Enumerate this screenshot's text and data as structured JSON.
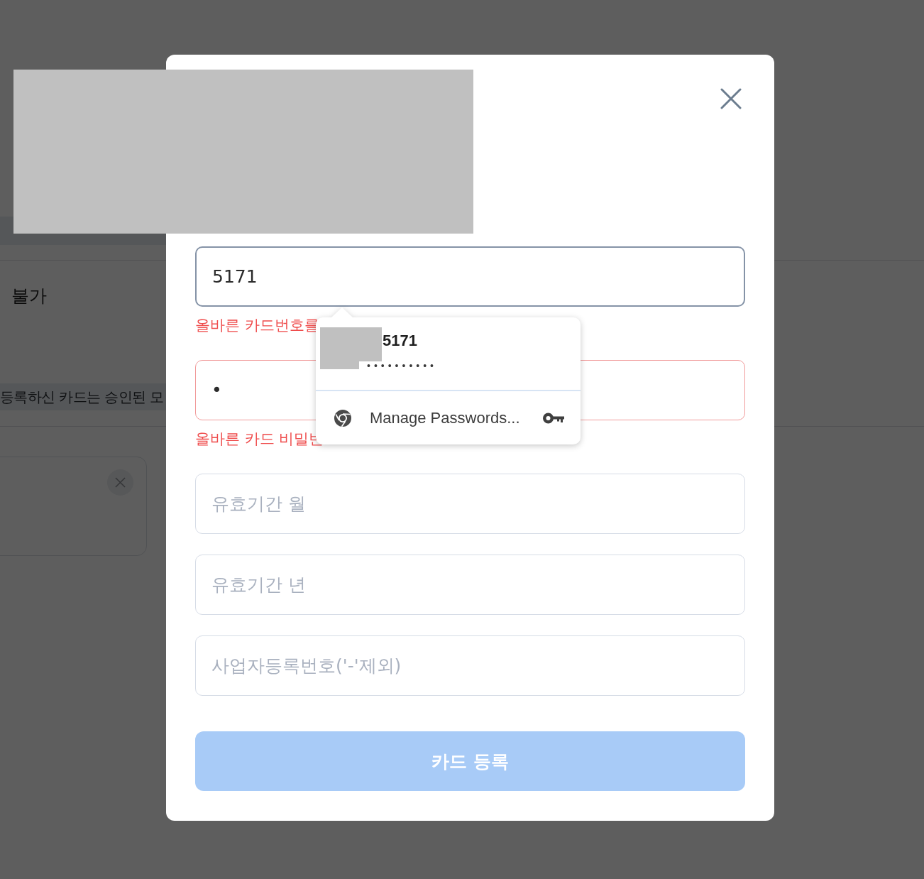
{
  "background_page": {
    "status_text": "불가",
    "notice": "등록하신 카드는 승인된 모"
  },
  "dialog": {
    "fields": [
      {
        "value": "5171",
        "focused": true,
        "invalid": true,
        "error": "올바른 카드번호를"
      },
      {
        "value": "•",
        "focused": false,
        "invalid": true,
        "error": "올바른 카드 비밀번"
      },
      {
        "placeholder": "유효기간 월",
        "focused": false,
        "invalid": false
      },
      {
        "placeholder": "유효기간 년",
        "focused": false,
        "invalid": false
      },
      {
        "placeholder": "사업자등록번호('-'제외)",
        "focused": false,
        "invalid": false
      }
    ],
    "submit": {
      "label": "카드 등록",
      "disabled": true
    }
  },
  "autofill_popup": {
    "username": "5171",
    "password": "••••••••••",
    "action": "Manage Passwords..."
  }
}
